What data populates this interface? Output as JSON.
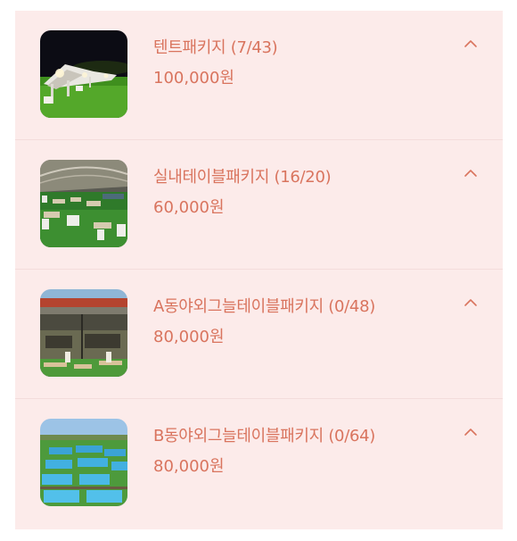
{
  "packages": [
    {
      "title": "텐트패키지 (7/43)",
      "price": "100,000원",
      "image_icon": "tent-photo",
      "expand_icon": "chevron-up-icon"
    },
    {
      "title": "실내테이블패키지 (16/20)",
      "price": "60,000원",
      "image_icon": "indoor-hall-photo",
      "expand_icon": "chevron-up-icon"
    },
    {
      "title": "A동야외그늘테이블패키지 (0/48)",
      "price": "80,000원",
      "image_icon": "outdoor-shade-photo",
      "expand_icon": "chevron-up-icon"
    },
    {
      "title": "B동야외그늘테이블패키지 (0/64)",
      "price": "80,000원",
      "image_icon": "aerial-shade-photo",
      "expand_icon": "chevron-up-icon"
    }
  ],
  "colors": {
    "background": "#fcebea",
    "accent_text": "#d9745e",
    "divider": "#f3dcdb"
  }
}
